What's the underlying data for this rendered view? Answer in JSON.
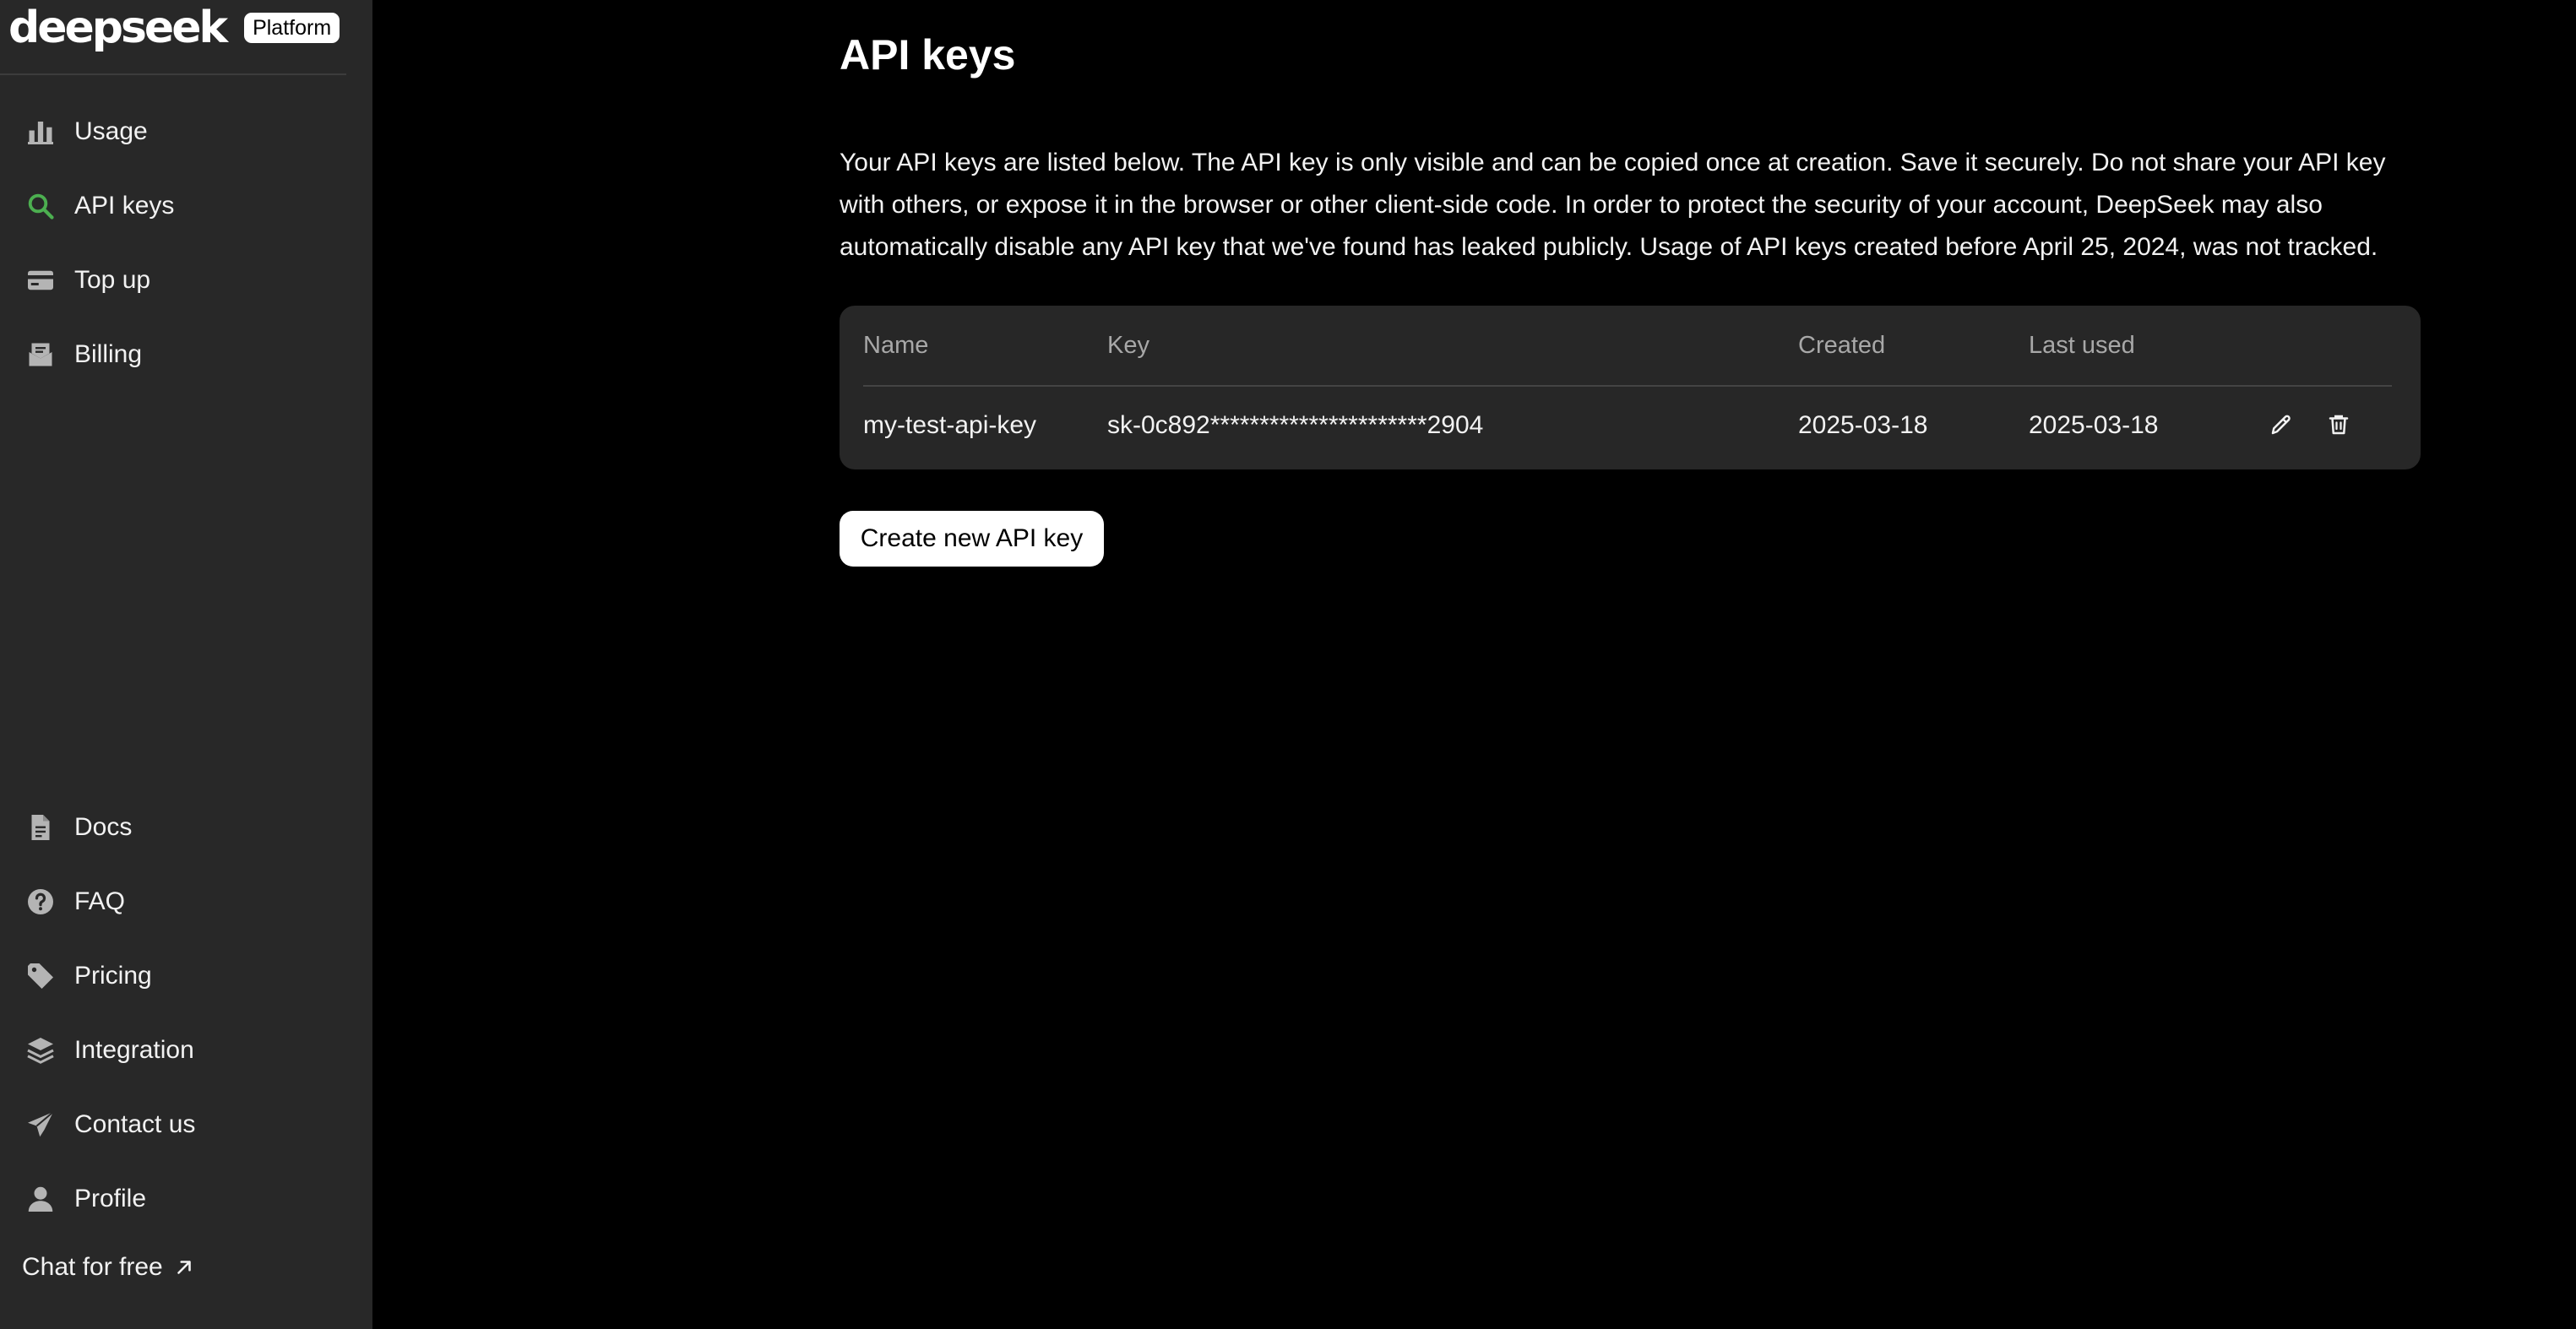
{
  "brand": {
    "logo_text": "deepseek",
    "badge": "Platform"
  },
  "sidebar": {
    "top_items": [
      {
        "label": "Usage",
        "icon": "bar-chart-icon",
        "active": false
      },
      {
        "label": "API keys",
        "icon": "search-icon",
        "active": true,
        "accent": "#4caf50"
      },
      {
        "label": "Top up",
        "icon": "card-icon",
        "active": false
      },
      {
        "label": "Billing",
        "icon": "billing-icon",
        "active": false
      }
    ],
    "bottom_items": [
      {
        "label": "Docs",
        "icon": "document-icon"
      },
      {
        "label": "FAQ",
        "icon": "question-icon"
      },
      {
        "label": "Pricing",
        "icon": "tag-icon"
      },
      {
        "label": "Integration",
        "icon": "layers-icon"
      },
      {
        "label": "Contact us",
        "icon": "send-icon"
      },
      {
        "label": "Profile",
        "icon": "person-icon"
      }
    ],
    "chat_free_label": "Chat for free"
  },
  "main": {
    "title": "API keys",
    "description": "Your API keys are listed below. The API key is only visible and can be copied once at creation. Save it securely. Do not share your API key with others, or expose it in the browser or other client-side code. In order to protect the security of your account, DeepSeek may also automatically disable any API key that we've found has leaked publicly. Usage of API keys created before April 25, 2024, was not tracked.",
    "table": {
      "headers": [
        "Name",
        "Key",
        "Created",
        "Last used"
      ],
      "rows": [
        {
          "name": "my-test-api-key",
          "key": "sk-0c892**********************2904",
          "created": "2025-03-18",
          "last_used": "2025-03-18"
        }
      ]
    },
    "create_button_label": "Create new API key"
  },
  "colors": {
    "background": "#000000",
    "sidebar": "#282828",
    "table_bg": "#272727",
    "accent": "#4caf50",
    "icon_gray": "#b4b4b4"
  }
}
